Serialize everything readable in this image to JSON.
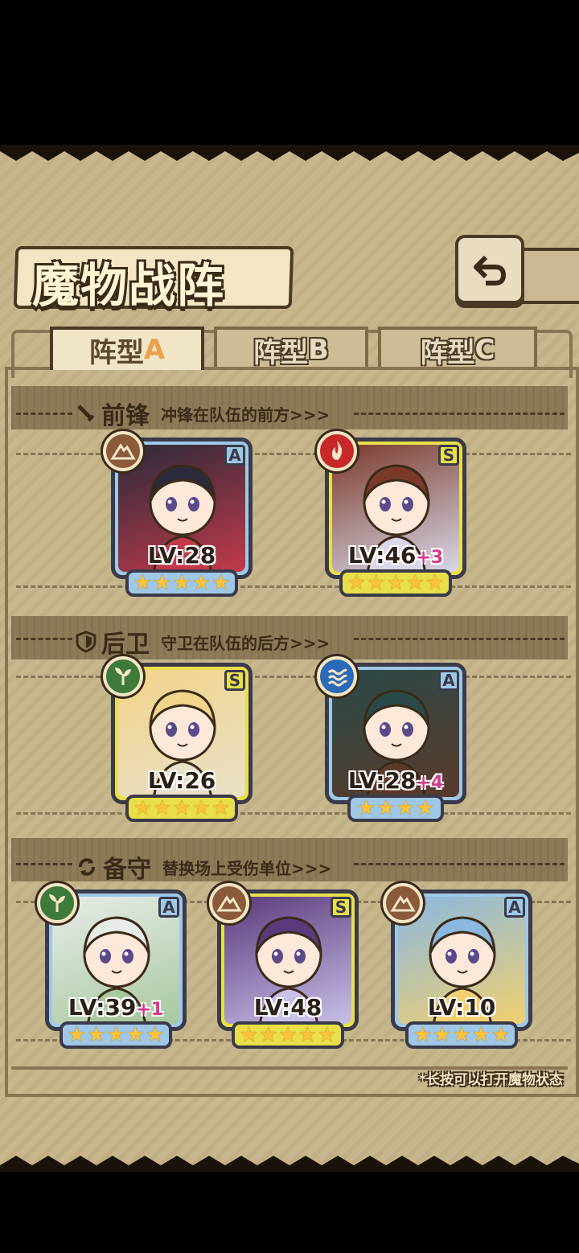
{
  "title": "魔物战阵",
  "back_button": {
    "icon": "back-arrow-icon"
  },
  "tabs": [
    {
      "prefix": "阵型",
      "letter": "A",
      "active": true
    },
    {
      "prefix": "阵型",
      "letter": "B",
      "active": false
    },
    {
      "prefix": "阵型",
      "letter": "C",
      "active": false
    }
  ],
  "sections": {
    "front": {
      "name": "前锋",
      "desc": "冲锋在队伍的前方>>>",
      "icon": "sword-icon"
    },
    "rear": {
      "name": "后卫",
      "desc": "守卫在队伍的后方>>>",
      "icon": "shield-icon"
    },
    "reserve": {
      "name": "备守",
      "desc": "替换场上受伤单位>>>",
      "icon": "swap-icon"
    }
  },
  "cards": [
    {
      "rank": "A",
      "element": "earth",
      "level": "LV:28",
      "bonus": "",
      "stars": 5,
      "frame": "blue"
    },
    {
      "rank": "S",
      "element": "fire",
      "level": "LV:46",
      "bonus": "+3",
      "stars": 5,
      "frame": "yellow"
    },
    {
      "rank": "S",
      "element": "wood",
      "level": "LV:26",
      "bonus": "",
      "stars": 5,
      "frame": "yellow"
    },
    {
      "rank": "A",
      "element": "water",
      "level": "LV:28",
      "bonus": "+4",
      "stars": 4,
      "frame": "blue"
    },
    {
      "rank": "A",
      "element": "wood",
      "level": "LV:39",
      "bonus": "+1",
      "stars": 5,
      "frame": "blue"
    },
    {
      "rank": "S",
      "element": "earth",
      "level": "LV:48",
      "bonus": "",
      "stars": 5,
      "frame": "yellow"
    },
    {
      "rank": "A",
      "element": "earth",
      "level": "LV:10",
      "bonus": "",
      "stars": 5,
      "frame": "blue"
    }
  ],
  "footer_note": "*长按可以打开魔物状态",
  "colors": {
    "panel": "#c7b78c",
    "frame_blue": "#9ec8e6",
    "frame_yellow": "#e8df4a",
    "element_earth": "#8a5a3a",
    "element_fire": "#c8282a",
    "element_wood": "#3e7a3a",
    "element_water": "#2a6ab8"
  }
}
